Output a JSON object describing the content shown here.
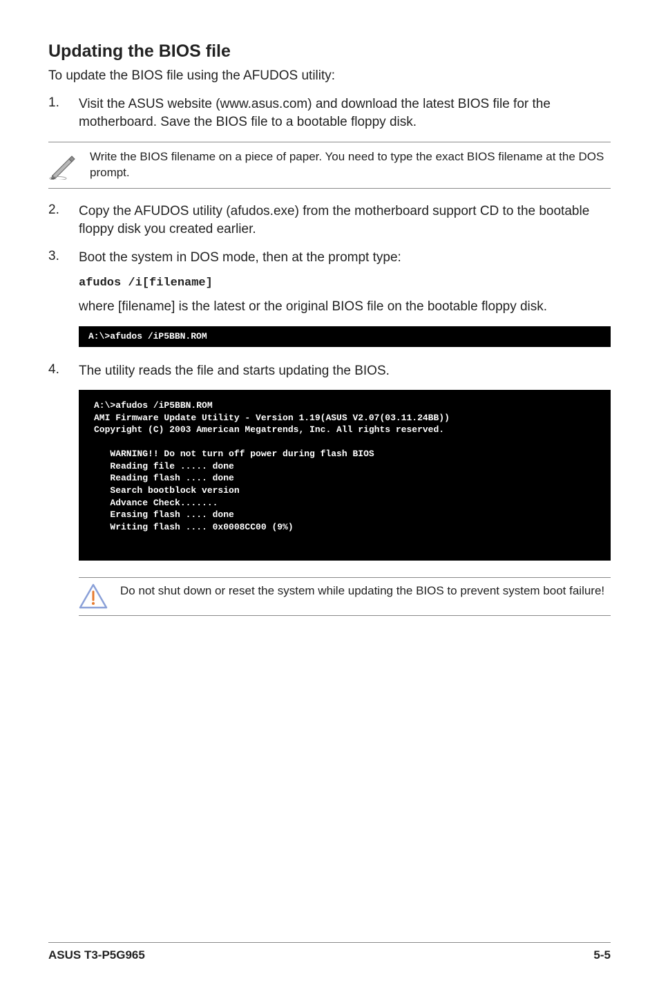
{
  "heading": "Updating the BIOS file",
  "intro": "To update the BIOS file using the AFUDOS utility:",
  "step1_num": "1.",
  "step1_text": "Visit the ASUS website (www.asus.com) and download the latest BIOS file for the motherboard. Save the BIOS file to a bootable floppy disk.",
  "note1": "Write the BIOS filename on a piece of paper. You need to type the exact BIOS filename at the DOS prompt.",
  "step2_num": "2.",
  "step2_text": "Copy the AFUDOS utility (afudos.exe) from the motherboard support CD to the bootable floppy disk you created earlier.",
  "step3_num": "3.",
  "step3_text": "Boot the system in DOS mode, then at the prompt type:",
  "code_afudos": "afudos /i[filename]",
  "step3_explain": "where [filename] is the latest or the original BIOS file on the bootable floppy disk.",
  "terminal1": "A:\\>afudos /iP5BBN.ROM",
  "step4_num": "4.",
  "step4_text": "The utility reads the file and starts updating the BIOS.",
  "terminal2": "A:\\>afudos /iP5BBN.ROM\nAMI Firmware Update Utility - Version 1.19(ASUS V2.07(03.11.24BB))\nCopyright (C) 2003 American Megatrends, Inc. All rights reserved.\n\n   WARNING!! Do not turn off power during flash BIOS\n   Reading file ..... done\n   Reading flash .... done\n   Search bootblock version\n   Advance Check.......\n   Erasing flash .... done\n   Writing flash .... 0x0008CC00 (9%)",
  "warning_text": "Do not shut down or reset the system while updating the BIOS to prevent system boot failure!",
  "footer_left": "ASUS T3-P5G965",
  "footer_right": "5-5"
}
